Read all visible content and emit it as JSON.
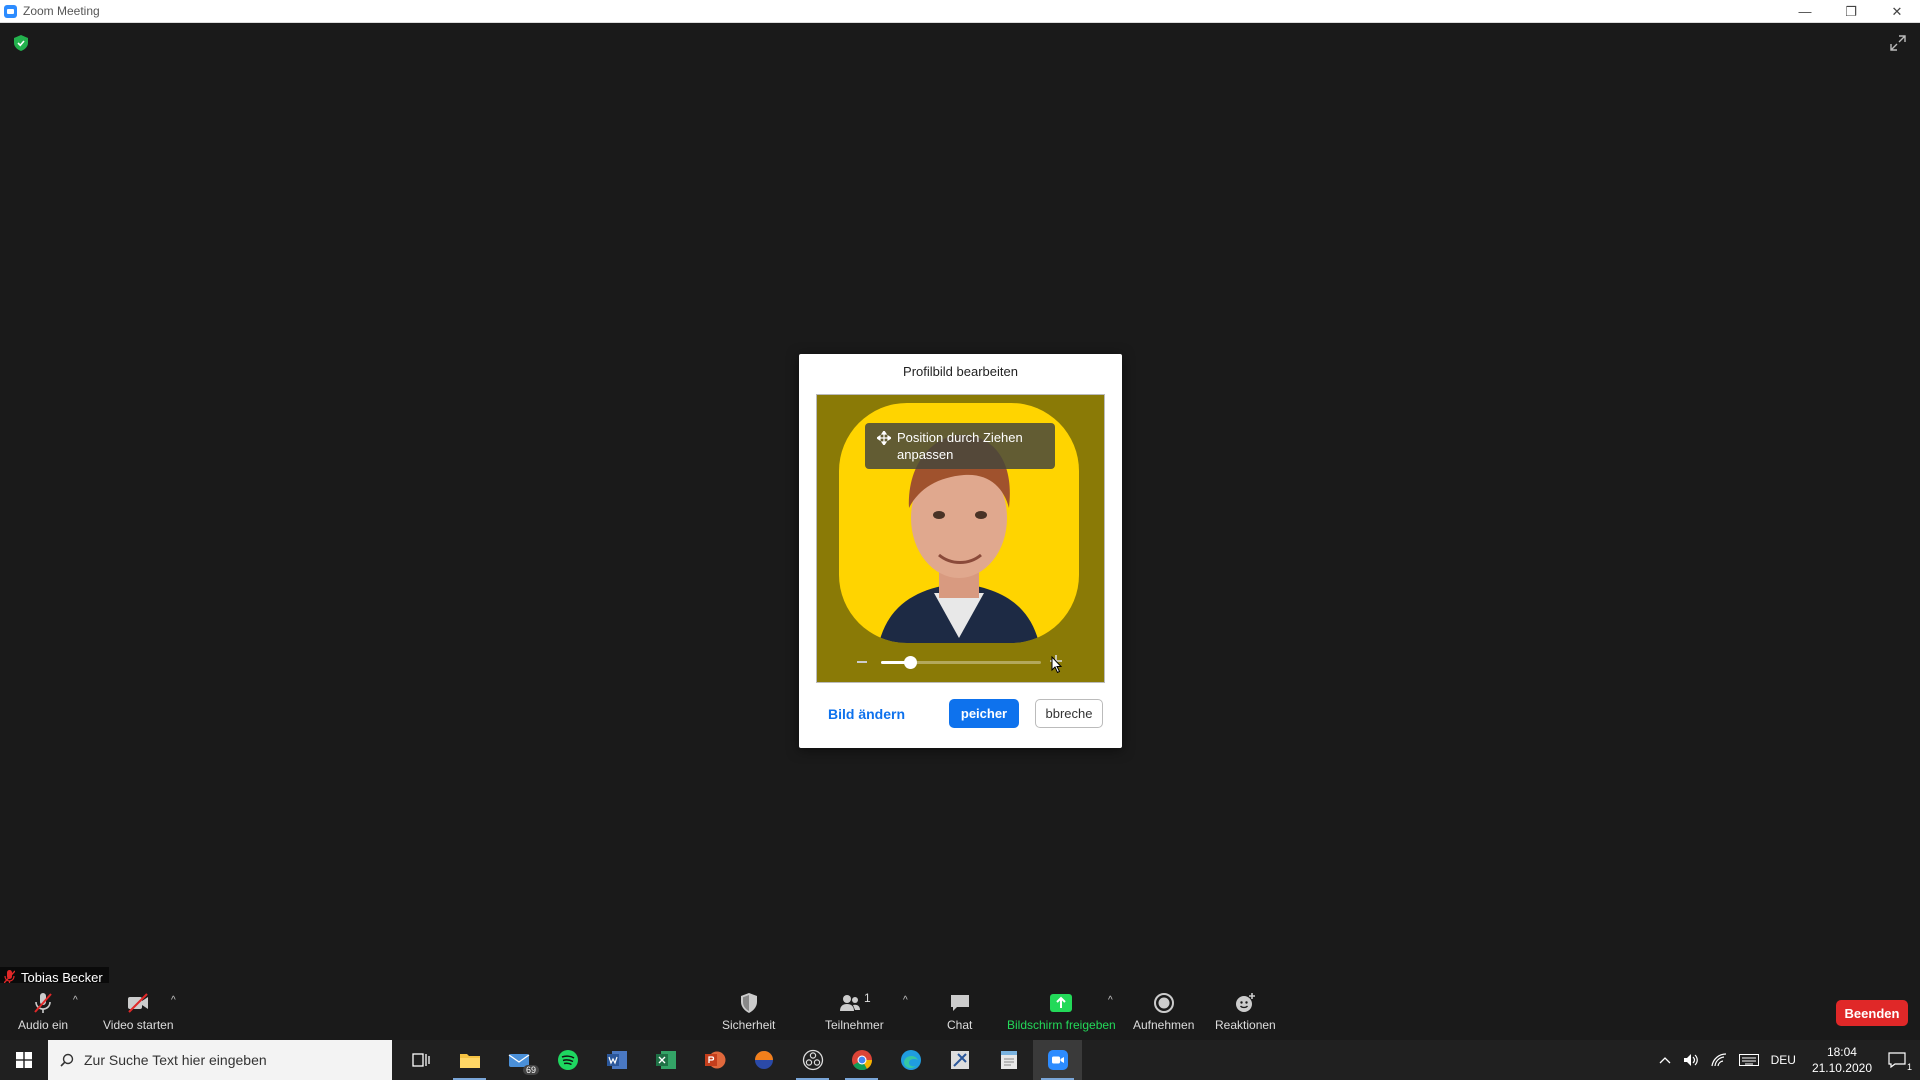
{
  "window": {
    "title": "Zoom Meeting",
    "minimize": "—",
    "restore": "❐",
    "close": "✕"
  },
  "dialog": {
    "title": "Profilbild bearbeiten",
    "tooltip": "Position durch Ziehen anpassen",
    "zoom_level": 0.18,
    "change_label": "Bild ändern",
    "save_label": "peicher",
    "cancel_label": "bbreche"
  },
  "participant": {
    "name": "Tobias Becker"
  },
  "toolbar": {
    "audio_label": "Audio ein",
    "video_label": "Video starten",
    "security_label": "Sicherheit",
    "participants_label": "Teilnehmer",
    "participants_count": "1",
    "chat_label": "Chat",
    "share_label": "Bildschirm freigeben",
    "record_label": "Aufnehmen",
    "reactions_label": "Reaktionen",
    "end_label": "Beenden",
    "caret": "^"
  },
  "taskbar": {
    "search_placeholder": "Zur Suche Text hier eingeben",
    "mail_badge": "69",
    "language": "DEU",
    "time": "18:04",
    "date": "21.10.2020",
    "notification_count": "1"
  },
  "colors": {
    "accent": "#0e72ed",
    "share_green": "#23d959",
    "end_red": "#e02828",
    "photo_bg": "#ffd400"
  }
}
